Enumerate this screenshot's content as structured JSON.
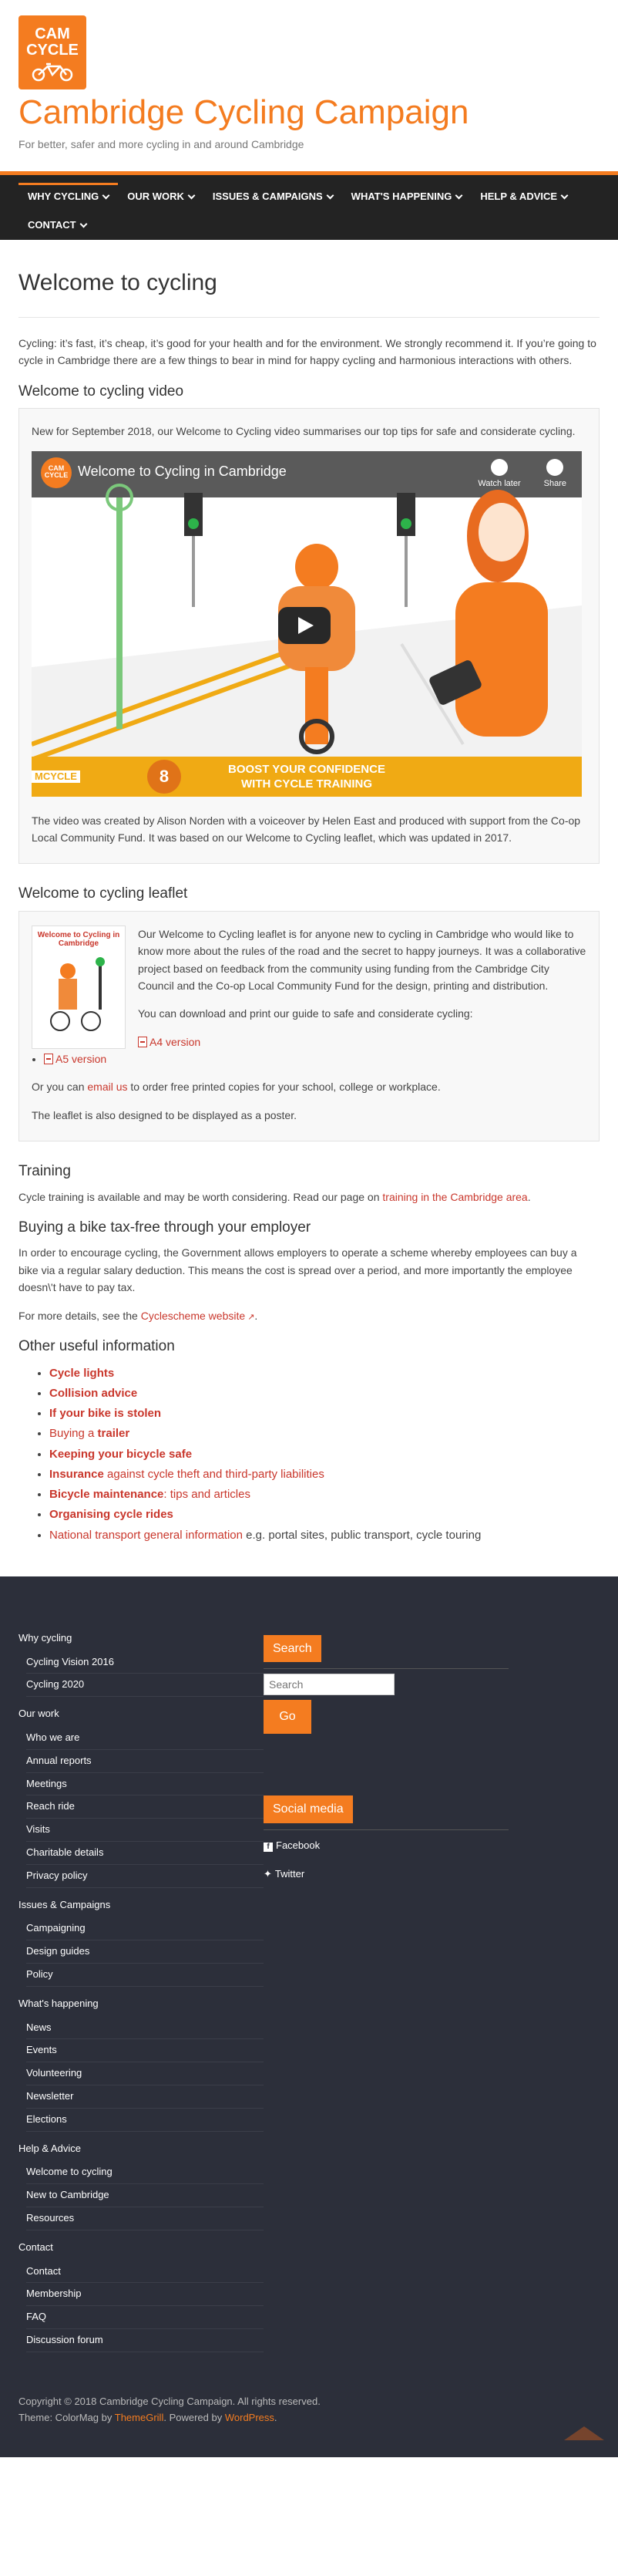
{
  "header": {
    "logo_line1": "CAM",
    "logo_line2": "CYCLE",
    "title": "Cambridge Cycling Campaign",
    "tagline": "For better, safer and more cycling in and around Cambridge"
  },
  "nav": [
    "WHY CYCLING",
    "OUR WORK",
    "ISSUES & CAMPAIGNS",
    "WHAT'S HAPPENING",
    "HELP & ADVICE",
    "CONTACT"
  ],
  "page": {
    "title": "Welcome to cycling",
    "intro": "Cycling: it’s fast, it’s cheap, it’s good for your health and for the environment. We strongly recommend it. If you’re going to cycle in Cambridge there are a few things to bear in mind for happy cycling and harmonious interactions with others."
  },
  "video_section": {
    "heading": "Welcome to cycling video",
    "intro": "New for September 2018, our Welcome to Cycling video summarises our top tips for safe and considerate cycling.",
    "video_title": "Welcome to Cycling in Cambridge",
    "avatar_text": "CAM CYCLE",
    "watch_later": "Watch later",
    "share": "Share",
    "banner_number": "8",
    "banner_line1": "BOOST YOUR CONFIDENCE",
    "banner_line2": "WITH CYCLE TRAINING",
    "banner_corner": "MCYCLE",
    "credits": "The video was created by Alison Norden with a voiceover by Helen East and produced with support from the Co-op Local Community Fund. It was based on our Welcome to Cycling leaflet, which was updated in 2017."
  },
  "leaflet_section": {
    "heading": "Welcome to cycling leaflet",
    "image_title": "Welcome to Cycling in Cambridge",
    "body": "Our Welcome to Cycling leaflet is for anyone new to cycling in Cambridge who would like to know more about the rules of the road and the secret to happy journeys. It was a collaborative project based on feedback from the community using funding from the Cambridge City Council and the Co-op Local Community Fund for the design, printing and distribution.",
    "download_text": "You can download and print our guide to safe and considerate cycling:",
    "a4": "A4 version",
    "a5": "A5 version",
    "order_pre": "Or you can ",
    "order_link": "email us",
    "order_post": " to order free printed copies for your school, college or workplace.",
    "poster": "The leaflet is also designed to be displayed as a poster."
  },
  "training": {
    "heading": "Training",
    "text_pre": "Cycle training is available and may be worth considering. Read our page on ",
    "link": "training in the Cambridge area",
    "text_post": "."
  },
  "taxfree": {
    "heading": "Buying a bike tax-free through your employer",
    "body": "In order to encourage cycling, the Government allows employers to operate a scheme whereby employees can buy a bike via a regular salary deduction. This means the cost is spread over a period, and more importantly the employee doesn\\'t have to pay tax.",
    "details_pre": "For more details, see the ",
    "details_link": "Cyclescheme website",
    "details_post": "."
  },
  "useful": {
    "heading": "Other useful information",
    "items": [
      {
        "bold": "Cycle lights",
        "rest": "",
        "plain": ""
      },
      {
        "bold": "Collision advice",
        "rest": "",
        "plain": ""
      },
      {
        "bold": "If your bike is stolen",
        "rest": "",
        "plain": ""
      },
      {
        "bold": "",
        "rest": "Buying a ",
        "bold2": "trailer"
      },
      {
        "bold": "Keeping your bicycle safe",
        "rest": "",
        "plain": ""
      },
      {
        "bold": "Insurance",
        "rest": " against cycle theft and third-party liabilities",
        "plain": ""
      },
      {
        "bold": "Bicycle maintenance",
        "rest": ": tips and articles",
        "plain": ""
      },
      {
        "bold": "Organising cycle rides",
        "rest": "",
        "plain": ""
      },
      {
        "bold": "",
        "rest": "National transport general information",
        "plain": " e.g. portal sites, public transport, cycle touring"
      }
    ]
  },
  "footer": {
    "menus": [
      {
        "title": "Why cycling",
        "items": [
          "Cycling Vision 2016",
          "Cycling 2020"
        ]
      },
      {
        "title": "Our work",
        "items": [
          "Who we are",
          "Annual reports",
          "Meetings",
          "Reach ride",
          "Visits",
          "Charitable details",
          "Privacy policy"
        ]
      },
      {
        "title": "Issues & Campaigns",
        "items": [
          "Campaigning",
          "Design guides",
          "Policy"
        ]
      },
      {
        "title": "What's happening",
        "items": [
          "News",
          "Events",
          "Volunteering",
          "Newsletter",
          "Elections"
        ]
      },
      {
        "title": "Help & Advice",
        "items": [
          "Welcome to cycling",
          "New to Cambridge",
          "Resources"
        ]
      },
      {
        "title": "Contact",
        "items": [
          "Contact",
          "Membership",
          "FAQ",
          "Discussion forum"
        ]
      }
    ],
    "search_title": "Search",
    "search_placeholder": "Search",
    "go": "Go",
    "social_title": "Social media",
    "facebook": "Facebook",
    "twitter": "Twitter",
    "copyright": "Copyright © 2018 Cambridge Cycling Campaign. All rights reserved.",
    "theme_pre": "Theme: ColorMag by ",
    "theme_link": "ThemeGrill",
    "theme_mid": ". Powered by ",
    "wp_link": "WordPress",
    "theme_post": "."
  },
  "colors": {
    "brand_orange": "#f47c20",
    "link_red": "#c9372c",
    "nav_bg": "#232323",
    "footer_bg": "#2c2f3a"
  }
}
